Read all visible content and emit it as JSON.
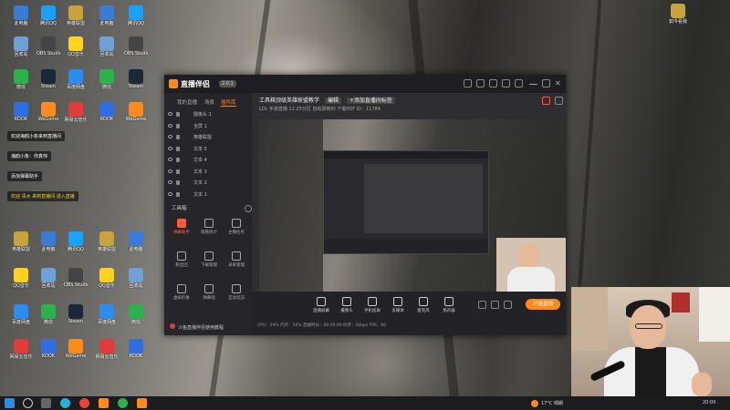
{
  "desktop_icons": [
    {
      "label": "此电脑",
      "color": "#3a7bd5"
    },
    {
      "label": "回收站",
      "color": "#6fa0d8"
    },
    {
      "label": "微信",
      "color": "#2bb24c"
    },
    {
      "label": "KOOK",
      "color": "#2f6ee0"
    },
    {
      "label": "英雄联盟",
      "color": "#c8a23a"
    },
    {
      "label": "QQ音乐",
      "color": "#ffd21f"
    },
    {
      "label": "百度网盘",
      "color": "#2c8cf0"
    },
    {
      "label": "网易云音乐",
      "color": "#e23b3b"
    },
    {
      "label": "腾讯QQ",
      "color": "#1aa1ff"
    },
    {
      "label": "OBS Studio",
      "color": "#444"
    },
    {
      "label": "Steam",
      "color": "#1b2838"
    },
    {
      "label": "WeGame",
      "color": "#ff8a1e"
    }
  ],
  "right_icon": {
    "label": "如今看我",
    "color": "#c8a23a"
  },
  "chat": [
    "欢迎海鸥小象来到直播间",
    "海鸥小象：你真帅",
    "添加弹幕助手",
    "欢迎 清水 来到直播间 进入直播"
  ],
  "taskbar": {
    "weather": "17°C 晴朗",
    "time": "20:00"
  },
  "app": {
    "name": "直播伴侣",
    "version": "2.0.1",
    "tabs": [
      "我的直播",
      "场景",
      "插件库"
    ],
    "sources": [
      "摄像头 1",
      "全屏 1",
      "英雄联盟",
      "文本 5",
      "文本 4",
      "文本 3",
      "文本 2",
      "文本 1"
    ],
    "tools_title": "工具箱",
    "tools": [
      {
        "label": "弹幕助手",
        "hl": true
      },
      {
        "label": "观看统计",
        "hl": false
      },
      {
        "label": "主播任务",
        "hl": false
      },
      {
        "label": "粉丝团",
        "hl": false
      },
      {
        "label": "下载管理",
        "hl": false
      },
      {
        "label": "录屏管理",
        "hl": false
      },
      {
        "label": "虚拟形象",
        "hl": false
      },
      {
        "label": "弹幕墙",
        "hl": false
      },
      {
        "label": "互动玩法",
        "hl": false
      }
    ],
    "notice": "斗鱼直播伴侣使用教程",
    "room_title": "工具箱顶级英雄联盟教学",
    "room_tag": "编辑",
    "room_extra": "+添加直播间标签",
    "room_info": "LOL  手游直播  12.25分区  自动录制ID  下载PDF  ID：11784",
    "bottom_buttons": [
      "直播屏幕",
      "摄像头",
      "手机投屏",
      "多媒体",
      "麦克风",
      "扬声器"
    ],
    "go_live": "开始直播",
    "stats": "CPU：24%   内存：50%   直播时长：00:00:00   码率：0kbps   FPS：60"
  }
}
